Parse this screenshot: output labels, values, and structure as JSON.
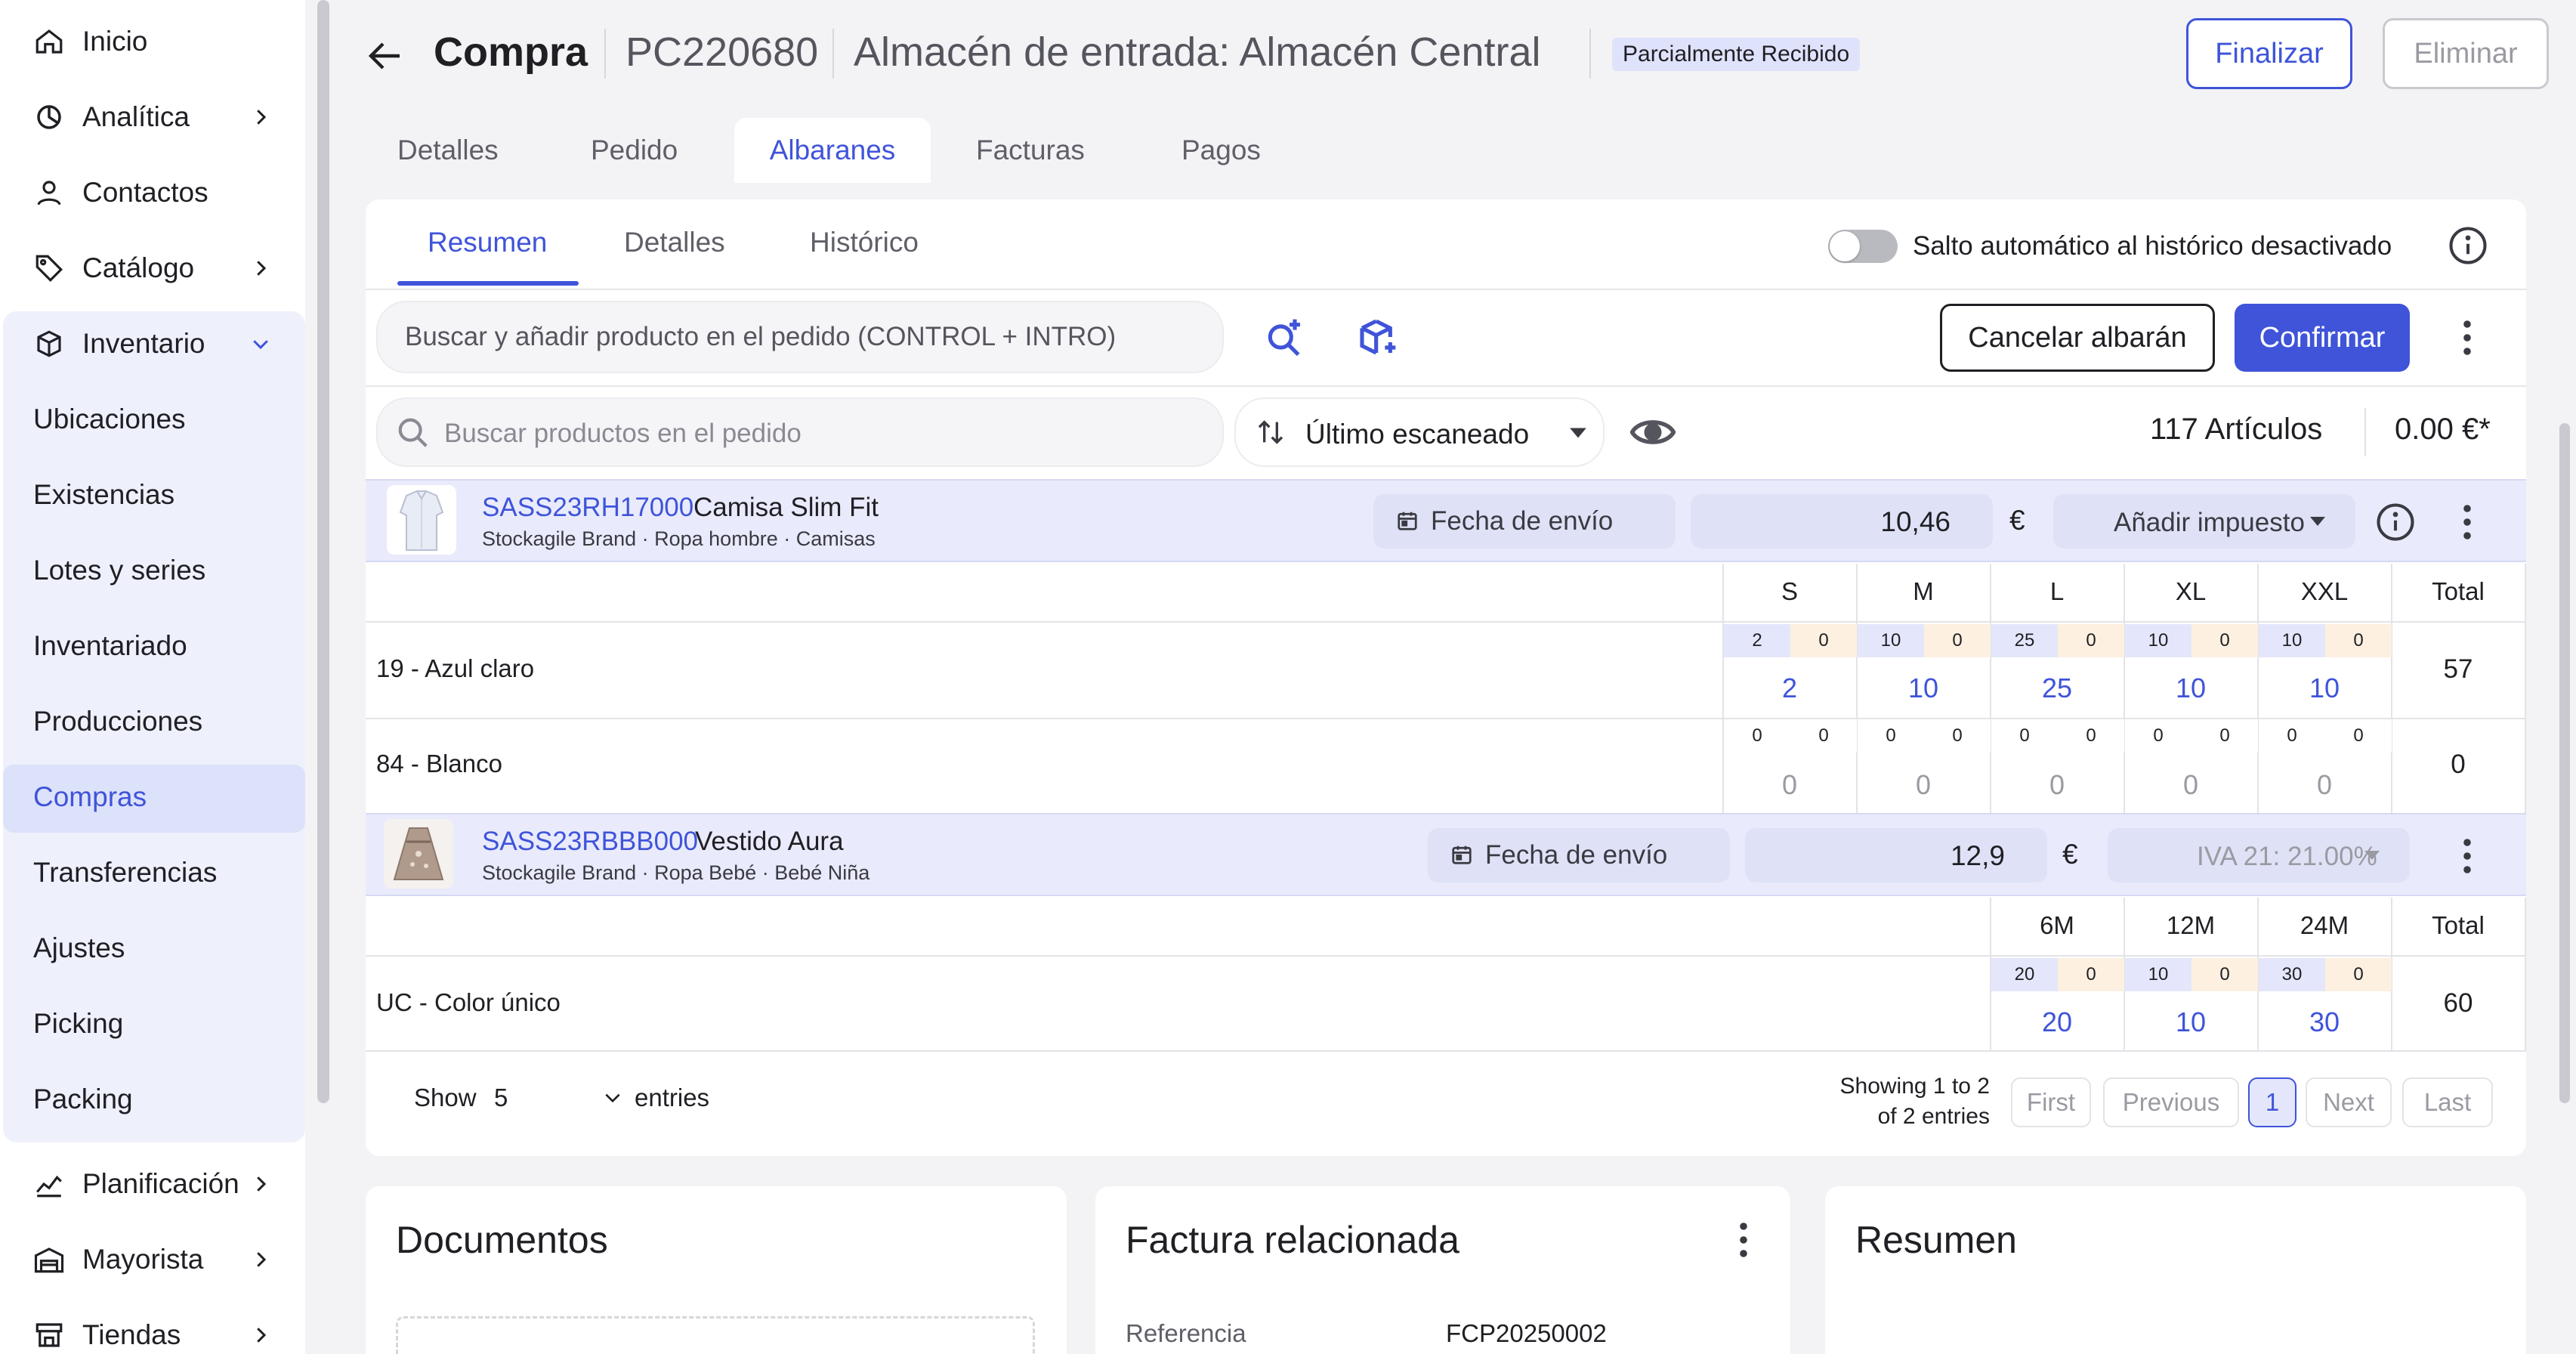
{
  "sidebar": {
    "items": [
      {
        "label": "Inicio",
        "icon": "home-icon"
      },
      {
        "label": "Analítica",
        "icon": "analytics-icon"
      },
      {
        "label": "Contactos",
        "icon": "user-icon"
      },
      {
        "label": "Catálogo",
        "icon": "tag-icon"
      },
      {
        "label": "Inventario",
        "icon": "box-icon"
      }
    ],
    "inventory_sub": [
      "Ubicaciones",
      "Existencias",
      "Lotes y series",
      "Inventariado",
      "Producciones",
      "Compras",
      "Transferencias",
      "Ajustes",
      "Picking",
      "Packing"
    ],
    "bottom_items": [
      {
        "label": "Planificación",
        "icon": "planning-icon"
      },
      {
        "label": "Mayorista",
        "icon": "warehouse-icon"
      },
      {
        "label": "Tiendas",
        "icon": "store-icon"
      }
    ]
  },
  "header": {
    "title": "Compra",
    "code": "PC220680",
    "warehouse": "Almacén de entrada: Almacén Central",
    "status": "Parcialmente Recibido",
    "finalizar": "Finalizar",
    "eliminar": "Eliminar"
  },
  "tabs": [
    "Detalles",
    "Pedido",
    "Albaranes",
    "Facturas",
    "Pagos"
  ],
  "subtabs": [
    "Resumen",
    "Detalles",
    "Histórico"
  ],
  "toggle_label": "Salto automático al histórico desactivado",
  "toolbar": {
    "add_placeholder": "Buscar y añadir producto en el pedido (CONTROL + INTRO)",
    "cancel": "Cancelar albarán",
    "confirm": "Confirmar",
    "search_placeholder": "Buscar productos en el pedido",
    "sort": "Último escaneado",
    "articles": "117 Artículos",
    "total": "0.00 €*"
  },
  "products": [
    {
      "code": "SASS23RH17000",
      "name": "Camisa Slim Fit",
      "meta": "Stockagile Brand · Ropa hombre · Camisas",
      "ship": "Fecha de envío",
      "price": "10,46",
      "currency": "€",
      "tax": "Añadir impuesto",
      "sizes": [
        "S",
        "M",
        "L",
        "XL",
        "XXL"
      ],
      "total_label": "Total",
      "variants": [
        {
          "label": "19 - Azul claro",
          "ordered": [
            "2",
            "10",
            "25",
            "10",
            "10"
          ],
          "received": [
            "0",
            "0",
            "0",
            "0",
            "0"
          ],
          "qty": [
            "2",
            "10",
            "25",
            "10",
            "10"
          ],
          "total": "57"
        },
        {
          "label": "84 - Blanco",
          "ordered": [
            "0",
            "0",
            "0",
            "0",
            "0"
          ],
          "received": [
            "0",
            "0",
            "0",
            "0",
            "0"
          ],
          "qty": [
            "0",
            "0",
            "0",
            "0",
            "0"
          ],
          "total": "0"
        }
      ]
    },
    {
      "code": "SASS23RBBB000",
      "name": "Vestido Aura",
      "meta": "Stockagile Brand · Ropa Bebé · Bebé Niña",
      "ship": "Fecha de envío",
      "price": "12,9",
      "currency": "€",
      "tax": "IVA 21: 21.00%",
      "sizes": [
        "6M",
        "12M",
        "24M"
      ],
      "total_label": "Total",
      "variants": [
        {
          "label": "UC - Color único",
          "ordered": [
            "20",
            "10",
            "30"
          ],
          "received": [
            "0",
            "0",
            "0"
          ],
          "qty": [
            "20",
            "10",
            "30"
          ],
          "total": "60"
        }
      ]
    }
  ],
  "pagination": {
    "show": "Show",
    "show_value": "5",
    "entries": "entries",
    "showing_line1": "Showing 1 to 2",
    "showing_line2": "of 2 entries",
    "first": "First",
    "previous": "Previous",
    "page": "1",
    "next": "Next",
    "last": "Last"
  },
  "cards": {
    "documentos": "Documentos",
    "factura": "Factura relacionada",
    "referencia_label": "Referencia",
    "referencia_value": "FCP20250002",
    "resumen": "Resumen"
  },
  "colors": {
    "accent": "#3f54d9",
    "active_bg": "#dde2fb",
    "band_bg": "#e9ebfc"
  }
}
